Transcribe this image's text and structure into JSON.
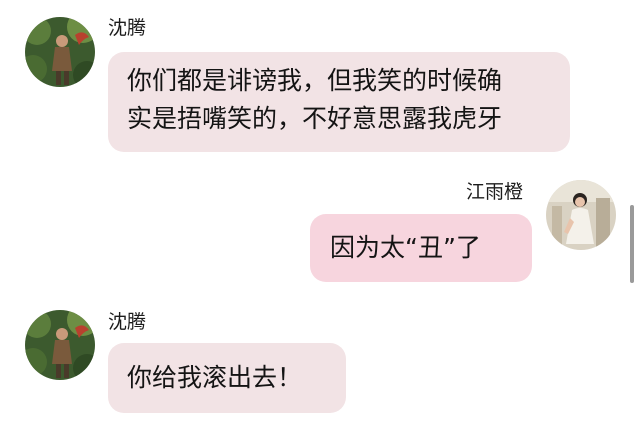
{
  "messages": [
    {
      "side": "left",
      "sender": "沈腾",
      "lines": [
        "你们都是诽谤我，但我笑的时候确",
        "实是捂嘴笑的，不好意思露我虎牙"
      ],
      "avatar_icon": "man-in-jungle-avatar"
    },
    {
      "side": "right",
      "sender": "江雨橙",
      "lines": [
        "因为太“丑”了"
      ],
      "avatar_icon": "woman-in-white-dress-avatar"
    },
    {
      "side": "left",
      "sender": "沈腾",
      "lines": [
        "你给我滚出去！"
      ],
      "avatar_icon": "man-in-jungle-avatar"
    }
  ],
  "colors": {
    "left_bubble": "#f2e3e5",
    "right_bubble": "#f7d5de",
    "background": "#ffffff"
  }
}
